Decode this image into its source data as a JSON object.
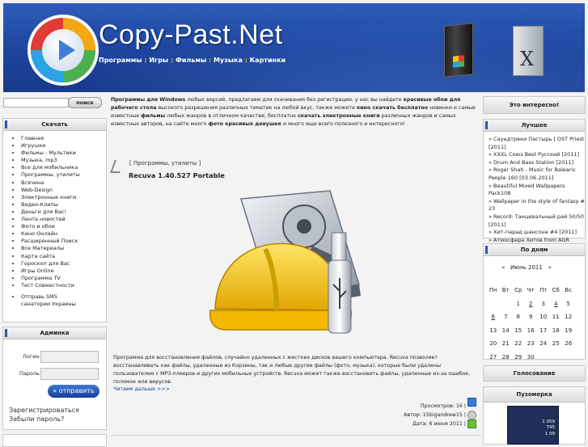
{
  "header": {
    "site_title": "Copy-Past.Net",
    "tagline": [
      {
        "text": "Программы",
        "style": "n"
      },
      {
        "text": " : ",
        "style": "o"
      },
      {
        "text": "Игры",
        "style": "n"
      },
      {
        "text": " : ",
        "style": "o"
      },
      {
        "text": "Фильмы",
        "style": "n"
      },
      {
        "text": " : ",
        "style": "o"
      },
      {
        "text": "Музыка",
        "style": "n"
      },
      {
        "text": " : ",
        "style": "o"
      },
      {
        "text": "Картинки",
        "style": "n"
      }
    ]
  },
  "search": {
    "button": "поиск",
    "value": ""
  },
  "left": {
    "download_title": "Скачать",
    "download_items": [
      "Главная",
      "Игрушки",
      "Фильмы - Мультики",
      "Музыка, mp3",
      "Все для мобильника",
      "Программы, утилиты",
      "Всячина",
      "Web-Design",
      "Электронные книги",
      "Видео-Клипы",
      "Деньги для Вас!",
      "Лента новостей",
      "Фото и обои",
      "Кино Онлайн",
      "Расширенный Поиск",
      "Все Материалы",
      "Карта сайта",
      "Гороскоп для Вас",
      "Игры Online",
      "Программа TV",
      "Тест Совместности",
      "Отправь SMS",
      "санатории Украины"
    ],
    "admin_title": "Админка",
    "login_label": "Логин",
    "password_label": "Пароль",
    "submit": "отправить",
    "register": "Зарегистрироваться",
    "forgot": "Забыли пароль?"
  },
  "main": {
    "intro_bold_1": "Программы для Windows",
    "intro_1": " любых версий, предлагаем для скачивания без регистрации, у нас вы найдете ",
    "intro_bold_2": "красивые обои для рабочего стола",
    "intro_2": " высокого разрешения различных тематик на любой вкус, также можете ",
    "intro_bold_3": "кино скачать бесплатно",
    "intro_3": " новинки и самые известные ",
    "intro_bold_4": "фильмы",
    "intro_4": " любых жанров в отличном качестве, бесплатно ",
    "intro_bold_5": "скачать электронные книги",
    "intro_5": " различных жанров и самых известных авторов, на сайте много ",
    "intro_bold_6": "фото красивых девушек",
    "intro_6": " и много еще всего полезного и интересного!",
    "article": {
      "category": "[ Программы, утилиты ]",
      "title": "Recuva 1.40.527 Portable",
      "description": "Программа для восстановления файлов, случайно удаленных с жестких дисков вашего компьютера. Recuva позволяет восстанавливать как файлы, удаленные из Корзины, так и любые другие файлы (фото, музыка), которые были удалены пользователем с МР3-плееров и других мобильных устройств. Recuva может также восстановить файлы, удаленные из-за ошибок, поломок или вирусов.",
      "more": "Читаем дальше >>>",
      "views": "Просмотров: 16 |",
      "author": "Автор: 15bigandrew15 |",
      "date": "Дата: 6 июня 2011 |"
    }
  },
  "right": {
    "interesting_title": "Это интересно!",
    "best_title": "Лучшее",
    "best_items": [
      "» Саундтреки Пастырь | OST Priest [2011]",
      "» XXXL Союз Best Русский [2011]",
      "» Drum And Bass Station [2011]",
      "» Roger Shah - Music for Balearic People 160 [03.06.2011]",
      "» Beautiful Mixed Wallpapers Pack108",
      "» Wallpaper in the style of fantasy # 23",
      "» Record: Танцевальный рай 50/50 [2011]",
      "» Хит-парад шансона #4 [2011]",
      "» Атмосфера Хитов from AGR [2011]",
      "» Лето на MTV Зарубежный [2011]"
    ],
    "by_day_title": "По дням",
    "calendar_header": "«   Июнь 2011   »",
    "weekdays": [
      "Пн",
      "Вт",
      "Ср",
      "Чт",
      "Пт",
      "Сб",
      "Вс"
    ],
    "weeks": [
      [
        "",
        "",
        "1",
        "2",
        "3",
        "4",
        "5"
      ],
      [
        "6",
        "7",
        "8",
        "9",
        "10",
        "11",
        "12"
      ],
      [
        "13",
        "14",
        "15",
        "16",
        "17",
        "18",
        "19"
      ],
      [
        "20",
        "21",
        "22",
        "23",
        "24",
        "25",
        "26"
      ],
      [
        "27",
        "28",
        "29",
        "30",
        "",
        "",
        ""
      ]
    ],
    "linked_days": [
      "2",
      "4",
      "6"
    ],
    "vote_title": "Голосование",
    "informer_title": "Пузомерка",
    "informer_vals": [
      "1 059",
      "Т45",
      "1 09"
    ]
  }
}
